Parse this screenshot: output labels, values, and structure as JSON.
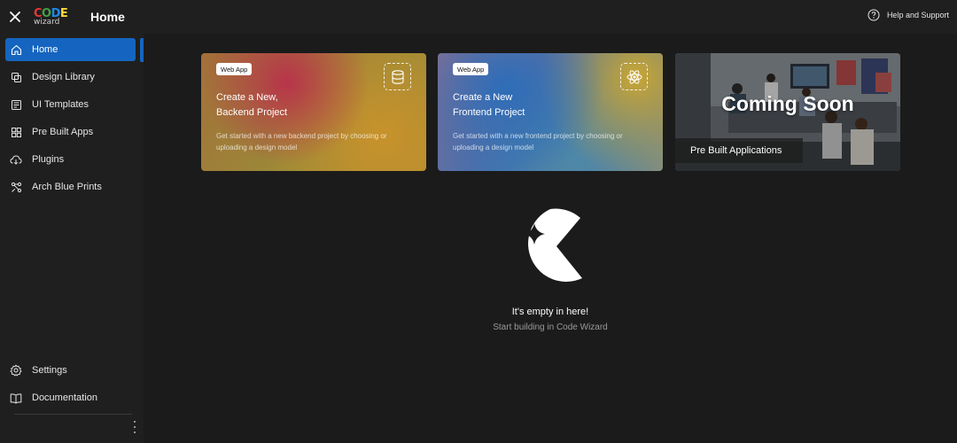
{
  "app": {
    "logo_word1": "CODE",
    "logo_word2": "wizard",
    "page_title": "Home",
    "help_label": "Help and Support"
  },
  "colors": {
    "accent": "#1565c0",
    "logo_c": "#e53935",
    "logo_o": "#43a047",
    "logo_d": "#1e88e5",
    "logo_e": "#fdd835"
  },
  "sidebar": {
    "items": [
      {
        "label": "Home",
        "icon": "home-icon",
        "active": true
      },
      {
        "label": "Design Library",
        "icon": "design-library-icon"
      },
      {
        "label": "UI Templates",
        "icon": "ui-templates-icon"
      },
      {
        "label": "Pre Built Apps",
        "icon": "pre-built-apps-icon"
      },
      {
        "label": "Plugins",
        "icon": "plugins-icon"
      },
      {
        "label": "Arch Blue Prints",
        "icon": "arch-blueprints-icon"
      }
    ],
    "bottom_items": [
      {
        "label": "Settings",
        "icon": "gear-icon"
      },
      {
        "label": "Documentation",
        "icon": "book-icon"
      }
    ]
  },
  "cards": {
    "backend": {
      "badge": "Web App",
      "title_line1": "Create a New,",
      "title_line2": "Backend Project",
      "description": "Get started with a new backend project by choosing or uploading a design model",
      "icon": "database-icon"
    },
    "frontend": {
      "badge": "Web App",
      "title_line1": "Create a New",
      "title_line2": "Frontend Project",
      "description": "Get started with a new frontend project by choosing or uploading a design model",
      "icon": "react-atom-icon"
    },
    "prebuilt": {
      "overlay_title": "Coming Soon",
      "label": "Pre Built Applications"
    }
  },
  "empty_state": {
    "title": "It's empty in here!",
    "subtitle": "Start building in Code Wizard",
    "icon": "code-wizard-logo-icon"
  }
}
